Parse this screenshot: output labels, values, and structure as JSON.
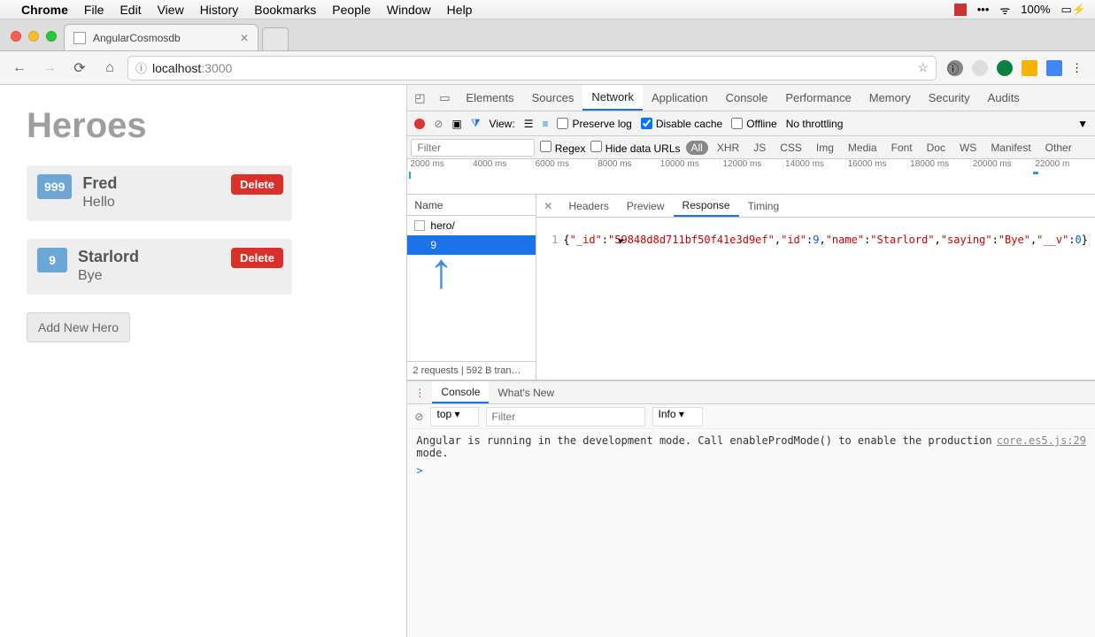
{
  "mac_menu": {
    "app": "Chrome",
    "items": [
      "File",
      "Edit",
      "View",
      "History",
      "Bookmarks",
      "People",
      "Window",
      "Help"
    ],
    "battery_pct": "100%"
  },
  "tab": {
    "title": "AngularCosmosdb"
  },
  "addr": {
    "host": "localhost",
    "port": ":3000"
  },
  "app": {
    "title": "Heroes",
    "heroes": [
      {
        "id": "999",
        "name": "Fred",
        "saying": "Hello"
      },
      {
        "id": "9",
        "name": "Starlord",
        "saying": "Bye"
      }
    ],
    "delete_label": "Delete",
    "add_label": "Add New Hero"
  },
  "devtools": {
    "tabs": [
      "Elements",
      "Sources",
      "Network",
      "Application",
      "Console",
      "Performance",
      "Memory",
      "Security",
      "Audits"
    ],
    "active_tab": "Network",
    "toolbar": {
      "view_label": "View:",
      "preserve_log": "Preserve log",
      "disable_cache": "Disable cache",
      "disable_cache_checked": true,
      "offline": "Offline",
      "throttle": "No throttling"
    },
    "filterbar": {
      "filter_placeholder": "Filter",
      "regex": "Regex",
      "hide_data": "Hide data URLs",
      "types": [
        "All",
        "XHR",
        "JS",
        "CSS",
        "Img",
        "Media",
        "Font",
        "Doc",
        "WS",
        "Manifest",
        "Other"
      ],
      "active_type": "All"
    },
    "timeline_ticks": [
      "2000 ms",
      "4000 ms",
      "6000 ms",
      "8000 ms",
      "10000 ms",
      "12000 ms",
      "14000 ms",
      "16000 ms",
      "18000 ms",
      "20000 ms",
      "22000 m"
    ],
    "requests": {
      "name_header": "Name",
      "rows": [
        {
          "name": "hero/",
          "selected": false
        },
        {
          "name": "9",
          "selected": true
        }
      ],
      "summary": "2 requests | 592 B tran…"
    },
    "detail": {
      "tabs": [
        "Headers",
        "Preview",
        "Response",
        "Timing"
      ],
      "active": "Response",
      "line_no": "1",
      "json": {
        "_id": "59848d8d711bf50f41e3d9ef",
        "id": 9,
        "name": "Starlord",
        "saying": "Bye",
        "__v": 0
      }
    },
    "console": {
      "tabs": [
        "Console",
        "What's New"
      ],
      "context": "top",
      "filter_placeholder": "Filter",
      "level": "Info",
      "message": "Angular is running in the development mode. Call enableProdMode() to enable the production mode.",
      "source": "core.es5.js:29",
      "prompt": ">"
    }
  }
}
